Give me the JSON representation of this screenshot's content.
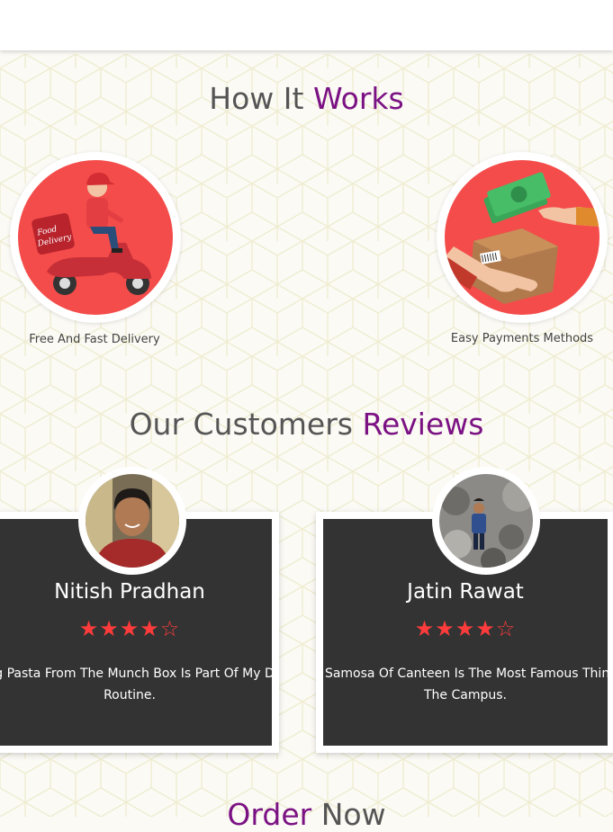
{
  "how_it_works": {
    "title_part1": "How It ",
    "title_part2": "Works",
    "steps": [
      {
        "label": "Free And Fast Delivery",
        "icon": "delivery-scooter-icon"
      },
      {
        "label": "Easy Payments Methods",
        "icon": "payment-exchange-icon"
      }
    ]
  },
  "reviews": {
    "title_part1": "Our Customers ",
    "title_part2": "Reviews",
    "items": [
      {
        "name": "Nitish Pradhan",
        "rating": 4,
        "max_rating": 5,
        "stars": "★★★★☆",
        "text": "Eating Pasta From The Munch Box Is Part Of My Daily Routine."
      },
      {
        "name": "Jatin Rawat",
        "rating": 4,
        "max_rating": 5,
        "stars": "★★★★☆",
        "text": "The Samosa Of Canteen Is The Most Famous Thing In The Campus."
      }
    ]
  },
  "order": {
    "title_part1": "Order ",
    "title_part2": "Now"
  },
  "colors": {
    "accent": "#7b1283",
    "heading": "#555555",
    "circle_bg": "#f44c4a",
    "card_bg": "#333333",
    "star": "#ff3b3b"
  }
}
